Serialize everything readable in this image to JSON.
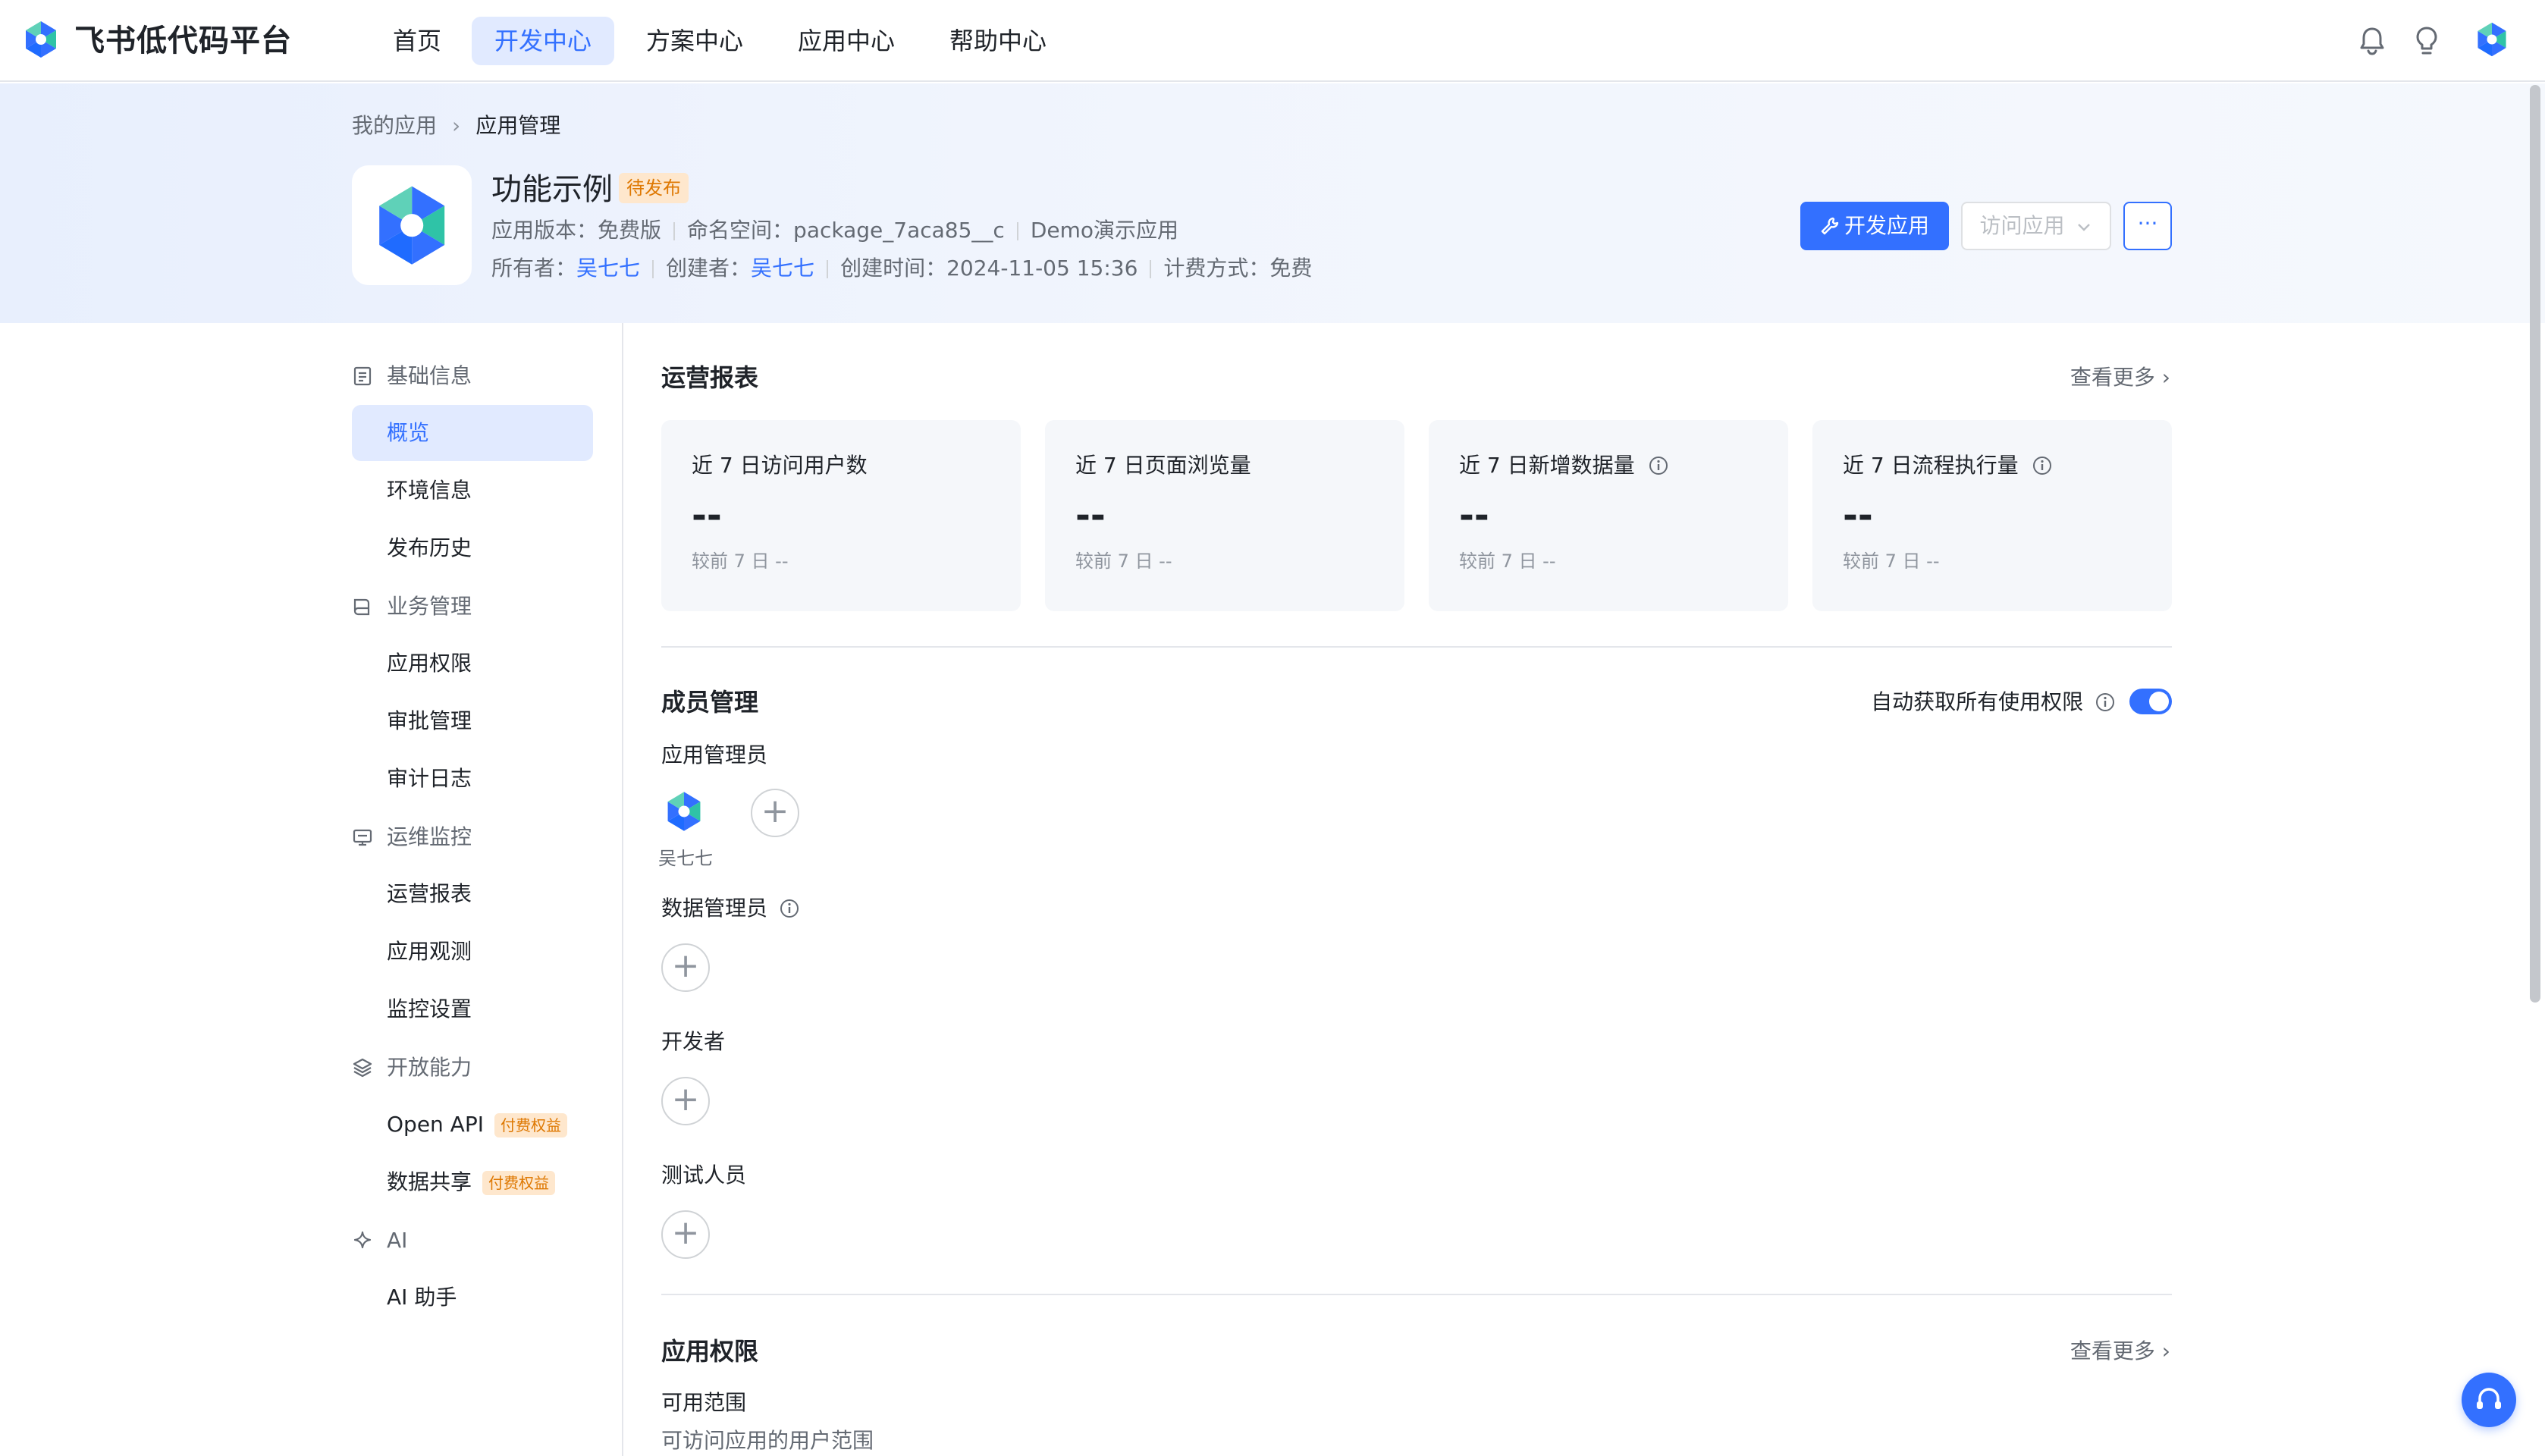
{
  "brand": {
    "name": "飞书低代码平台"
  },
  "nav": {
    "items": [
      {
        "label": "首页"
      },
      {
        "label": "开发中心"
      },
      {
        "label": "方案中心"
      },
      {
        "label": "应用中心"
      },
      {
        "label": "帮助中心"
      }
    ],
    "active": "开发中心"
  },
  "breadcrumb": {
    "parent": "我的应用",
    "current": "应用管理"
  },
  "app": {
    "title": "功能示例",
    "status": "待发布",
    "version_label": "应用版本：",
    "version": "免费版",
    "namespace_label": "命名空间：",
    "namespace": "package_7aca85__c",
    "description": "Demo演示应用",
    "owner_label": "所有者：",
    "owner": "吴七七",
    "creator_label": "创建者：",
    "creator": "吴七七",
    "created_label": "创建时间：",
    "created": "2024-11-05 15:36",
    "billing_label": "计费方式：",
    "billing": "免费"
  },
  "actions": {
    "develop": "开发应用",
    "visit": "访问应用",
    "more": "···"
  },
  "sidebar": {
    "groups": [
      {
        "label": "基础信息",
        "icon": "document-icon",
        "items": [
          "概览",
          "环境信息",
          "发布历史"
        ]
      },
      {
        "label": "业务管理",
        "icon": "book-icon",
        "items": [
          "应用权限",
          "审批管理",
          "审计日志"
        ]
      },
      {
        "label": "运维监控",
        "icon": "monitor-icon",
        "items": [
          "运营报表",
          "应用观测",
          "监控设置"
        ]
      },
      {
        "label": "开放能力",
        "icon": "layers-icon",
        "items": [
          "Open API",
          "数据共享"
        ]
      },
      {
        "label": "AI",
        "icon": "sparkle-icon",
        "items": [
          "AI 助手"
        ]
      }
    ],
    "active": "概览",
    "paid_tag": "付费权益"
  },
  "report": {
    "title": "运营报表",
    "see_more": "查看更多",
    "cards": [
      {
        "label": "近 7 日访问用户数",
        "value": "--",
        "compare": "较前 7 日   --",
        "info": false
      },
      {
        "label": "近 7 日页面浏览量",
        "value": "--",
        "compare": "较前 7 日   --",
        "info": false
      },
      {
        "label": "近 7 日新增数据量",
        "value": "--",
        "compare": "较前 7 日   --",
        "info": true
      },
      {
        "label": "近 7 日流程执行量",
        "value": "--",
        "compare": "较前 7 日   --",
        "info": true
      }
    ]
  },
  "members": {
    "title": "成员管理",
    "auto_perm_label": "自动获取所有使用权限",
    "auto_perm_enabled": true,
    "app_admin_label": "应用管理员",
    "admin_name": "吴七七",
    "data_admin_label": "数据管理员",
    "developer_label": "开发者",
    "tester_label": "测试人员",
    "add_symbol": "+"
  },
  "permissions": {
    "title": "应用权限",
    "see_more": "查看更多",
    "scope_label": "可用范围",
    "scope_desc": "可访问应用的用户范围"
  },
  "colors": {
    "accent": "#3370ff",
    "accent_light": "#e1eaff",
    "warning": "#de7802",
    "warning_bg": "#fee7cd"
  }
}
